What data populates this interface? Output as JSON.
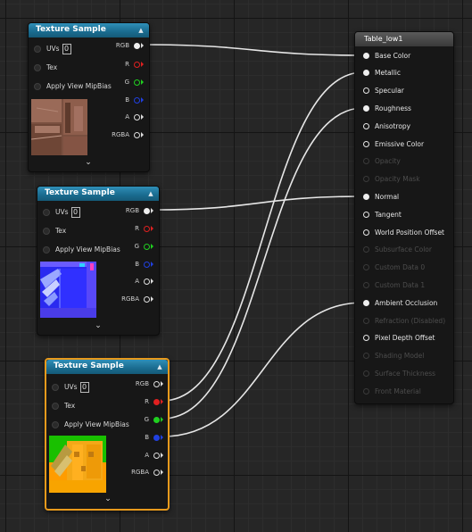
{
  "colors": {
    "red_pin": "#e02020",
    "green_pin": "#20d020",
    "blue_pin": "#2040e0",
    "white_pin": "#e8e8e8",
    "selection": "#e89a1c"
  },
  "texture_nodes": [
    {
      "title": "Texture Sample",
      "inputs": {
        "uvs_label": "UVs",
        "uvs_value": "0",
        "tex_label": "Tex",
        "mip_label": "Apply View MipBias"
      },
      "outputs": [
        "RGB",
        "R",
        "G",
        "B",
        "A",
        "RGBA"
      ],
      "selected": false
    },
    {
      "title": "Texture Sample",
      "inputs": {
        "uvs_label": "UVs",
        "uvs_value": "0",
        "tex_label": "Tex",
        "mip_label": "Apply View MipBias"
      },
      "outputs": [
        "RGB",
        "R",
        "G",
        "B",
        "A",
        "RGBA"
      ],
      "selected": false
    },
    {
      "title": "Texture Sample",
      "inputs": {
        "uvs_label": "UVs",
        "uvs_value": "0",
        "tex_label": "Tex",
        "mip_label": "Apply View MipBias"
      },
      "outputs": [
        "RGB",
        "R",
        "G",
        "B",
        "A",
        "RGBA"
      ],
      "selected": true
    }
  ],
  "material": {
    "title": "Table_low1",
    "inputs": [
      {
        "label": "Base Color",
        "enabled": true,
        "connected": true
      },
      {
        "label": "Metallic",
        "enabled": true,
        "connected": true
      },
      {
        "label": "Specular",
        "enabled": true,
        "connected": false
      },
      {
        "label": "Roughness",
        "enabled": true,
        "connected": true
      },
      {
        "label": "Anisotropy",
        "enabled": true,
        "connected": false
      },
      {
        "label": "Emissive Color",
        "enabled": true,
        "connected": false
      },
      {
        "label": "Opacity",
        "enabled": false,
        "connected": false
      },
      {
        "label": "Opacity Mask",
        "enabled": false,
        "connected": false
      },
      {
        "label": "Normal",
        "enabled": true,
        "connected": true
      },
      {
        "label": "Tangent",
        "enabled": true,
        "connected": false
      },
      {
        "label": "World Position Offset",
        "enabled": true,
        "connected": false
      },
      {
        "label": "Subsurface Color",
        "enabled": false,
        "connected": false
      },
      {
        "label": "Custom Data 0",
        "enabled": false,
        "connected": false
      },
      {
        "label": "Custom Data 1",
        "enabled": false,
        "connected": false
      },
      {
        "label": "Ambient Occlusion",
        "enabled": true,
        "connected": true
      },
      {
        "label": "Refraction (Disabled)",
        "enabled": false,
        "connected": false
      },
      {
        "label": "Pixel Depth Offset",
        "enabled": true,
        "connected": false
      },
      {
        "label": "Shading Model",
        "enabled": false,
        "connected": false
      },
      {
        "label": "Surface Thickness",
        "enabled": false,
        "connected": false
      },
      {
        "label": "Front Material",
        "enabled": false,
        "connected": false
      }
    ]
  }
}
